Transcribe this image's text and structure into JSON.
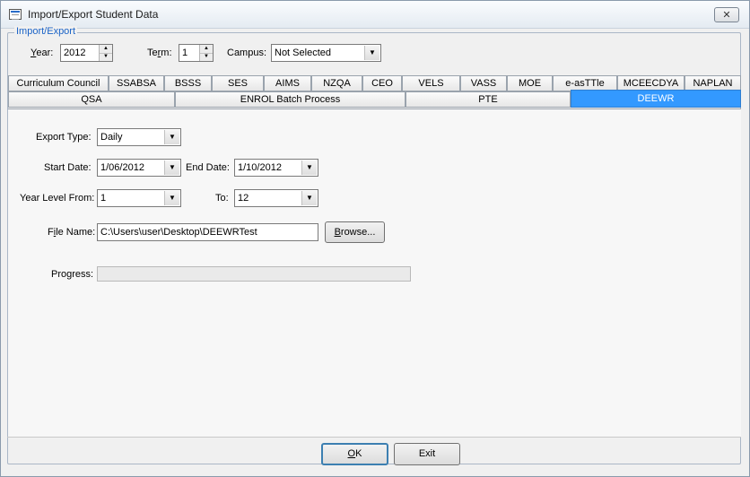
{
  "window": {
    "title": "Import/Export Student Data",
    "close_symbol": "✕"
  },
  "group": {
    "title": "Import/Export"
  },
  "filters": {
    "year_label_pre": "",
    "year_label_ul": "Y",
    "year_label_post": "ear:",
    "year_value": "2012",
    "term_label_pre": "Te",
    "term_label_ul": "r",
    "term_label_post": "m:",
    "term_value": "1",
    "campus_label": "Campus:",
    "campus_value": "Not Selected"
  },
  "tabs_row1": [
    "Curriculum Council",
    "SSABSA",
    "BSSS",
    "SES",
    "AIMS",
    "NZQA",
    "CEO",
    "VELS",
    "VASS",
    "MOE",
    "e-asTTle",
    "MCEECDYA",
    "NAPLAN"
  ],
  "tabs_row2": [
    "QSA",
    "ENROL Batch Process",
    "PTE",
    "DEEWR"
  ],
  "active_tab": "DEEWR",
  "form": {
    "export_type_label": "Export Type:",
    "export_type_value": "Daily",
    "start_date_label": "Start Date:",
    "start_date_value": "1/06/2012",
    "end_date_label": "End Date:",
    "end_date_value": "1/10/2012",
    "year_level_from_label": "Year Level From:",
    "year_level_from_value": "1",
    "to_label": "To:",
    "to_value": "12",
    "file_name_label_pre": "F",
    "file_name_label_ul": "i",
    "file_name_label_post": "le Name:",
    "file_name_value": "C:\\Users\\user\\Desktop\\DEEWRTest",
    "browse_label_ul": "B",
    "browse_label_post": "rowse...",
    "progress_label": "Progress:",
    "progress_value": 0
  },
  "buttons": {
    "ok_ul": "O",
    "ok_post": "K",
    "exit_label": "Exit"
  },
  "icons": {
    "spin_up": "▲",
    "spin_down": "▼",
    "dropdown": "▼"
  }
}
